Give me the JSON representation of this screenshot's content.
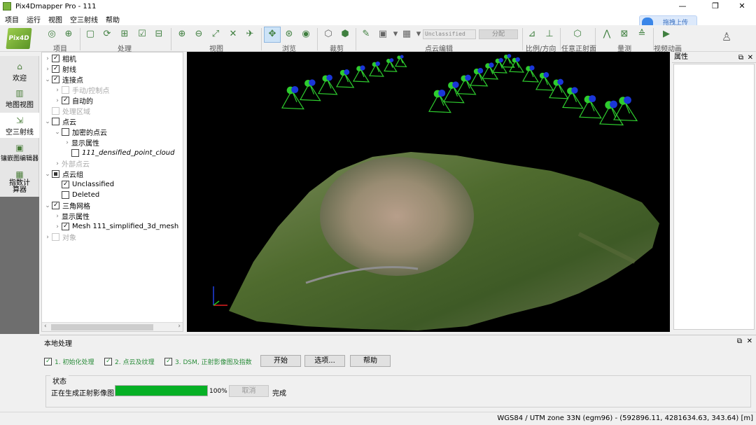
{
  "window": {
    "title": "Pix4Dmapper Pro - 111"
  },
  "menu": [
    "项目",
    "运行",
    "视图",
    "空三射线",
    "帮助"
  ],
  "upload": {
    "label": "拖拽上传"
  },
  "toolbar": {
    "logo": "Pix4D",
    "groups": [
      "项目",
      "处理",
      "视图",
      "浏览",
      "裁剪",
      "点云编辑",
      "比例/方向",
      "任意正射面",
      "量测",
      "视频动画"
    ],
    "class_combo": "Unclassified",
    "split_label": "分配"
  },
  "sidebar": [
    "欢迎",
    "地图视图",
    "空三射线",
    "镶嵌图编辑器",
    "指数计算器"
  ],
  "tree": [
    {
      "label": "相机",
      "check": "on",
      "arrow": "›",
      "indent": 0
    },
    {
      "label": "射线",
      "check": "on",
      "arrow": "›",
      "indent": 0
    },
    {
      "label": "连接点",
      "check": "on",
      "arrow": "⌄",
      "indent": 0
    },
    {
      "label": "手动/控制点",
      "check": "dis",
      "arrow": "›",
      "indent": 1,
      "dim": true
    },
    {
      "label": "自动的",
      "check": "on",
      "arrow": "›",
      "indent": 1
    },
    {
      "label": "处理区域",
      "check": "dis",
      "arrow": "",
      "indent": 0,
      "dim": true
    },
    {
      "label": "点云",
      "check": "off",
      "arrow": "⌄",
      "indent": 0
    },
    {
      "label": "加密的点云",
      "check": "off",
      "arrow": "⌄",
      "indent": 1
    },
    {
      "label": "显示属性",
      "check": "",
      "arrow": "›",
      "indent": 2
    },
    {
      "label": "111_densified_point_cloud",
      "check": "off",
      "arrow": "",
      "indent": 2,
      "italic": true
    },
    {
      "label": "外部点云",
      "check": "",
      "arrow": "›",
      "indent": 1,
      "dim": true
    },
    {
      "label": "点云组",
      "check": "part",
      "arrow": "⌄",
      "indent": 0
    },
    {
      "label": "Unclassified",
      "check": "on",
      "arrow": "",
      "indent": 1
    },
    {
      "label": "Deleted",
      "check": "off",
      "arrow": "",
      "indent": 1
    },
    {
      "label": "三角网格",
      "check": "on",
      "arrow": "⌄",
      "indent": 0
    },
    {
      "label": "显示属性",
      "check": "",
      "arrow": "›",
      "indent": 1
    },
    {
      "label": "Mesh 111_simplified_3d_mesh",
      "check": "on",
      "arrow": "›",
      "indent": 1
    },
    {
      "label": "对象",
      "check": "dis",
      "arrow": "›",
      "indent": 0,
      "dim": true
    }
  ],
  "properties": {
    "title": "属性"
  },
  "processing": {
    "title": "本地处理",
    "steps": [
      "1. 初始化处理",
      "2. 点云及纹理",
      "3. DSM, 正射影像图及指数"
    ],
    "start": "开始",
    "options": "选项...",
    "help": "帮助",
    "status_label": "状态",
    "status_text": "正在生成正射影像图",
    "progress": 1.0,
    "progress_text": "100%",
    "cancel": "取消",
    "done": "完成"
  },
  "statusbar": {
    "coords": "WGS84 / UTM zone 33N (egm96) - (592896.11, 4281634.63, 343.64) [m]"
  },
  "colors": {
    "camera_green": "#2ecc2e",
    "camera_blue": "#1a36d8",
    "progress": "#06b025"
  }
}
